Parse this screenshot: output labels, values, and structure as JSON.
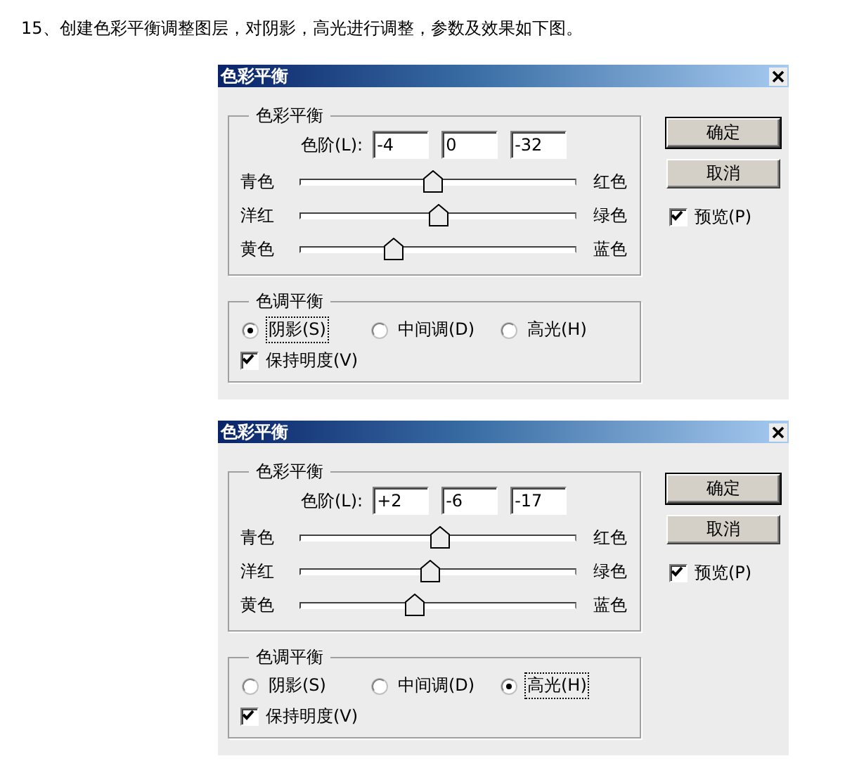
{
  "heading": "15、创建色彩平衡调整图层，对阴影，高光进行调整，参数及效果如下图。",
  "dialogs": [
    {
      "title": "色彩平衡",
      "color_balance": {
        "legend": "色彩平衡",
        "levels_label": "色阶(L):",
        "levels": [
          "-4",
          "0",
          "-32"
        ],
        "sliders": [
          {
            "left": "青色",
            "right": "红色",
            "level": 0.48
          },
          {
            "left": "洋红",
            "right": "绿色",
            "level": 0.5
          },
          {
            "left": "黄色",
            "right": "蓝色",
            "level": 0.34
          }
        ]
      },
      "tone_balance": {
        "legend": "色调平衡",
        "tones": [
          {
            "label": "阴影(S)",
            "selected": true
          },
          {
            "label": "中间调(D)",
            "selected": false
          },
          {
            "label": "高光(H)",
            "selected": false
          }
        ],
        "preserve": {
          "label": "保持明度(V)",
          "checked": true
        }
      },
      "buttons": [
        "确定",
        "取消"
      ],
      "preview": {
        "label": "预览(P)",
        "checked": true
      }
    },
    {
      "title": "色彩平衡",
      "color_balance": {
        "legend": "色彩平衡",
        "levels_label": "色阶(L):",
        "levels": [
          "+2",
          "-6",
          "-17"
        ],
        "sliders": [
          {
            "left": "青色",
            "right": "红色",
            "level": 0.51
          },
          {
            "left": "洋红",
            "right": "绿色",
            "level": 0.47
          },
          {
            "left": "黄色",
            "right": "蓝色",
            "level": 0.415
          }
        ]
      },
      "tone_balance": {
        "legend": "色调平衡",
        "tones": [
          {
            "label": "阴影(S)",
            "selected": false
          },
          {
            "label": "中间调(D)",
            "selected": false
          },
          {
            "label": "高光(H)",
            "selected": true
          }
        ],
        "preserve": {
          "label": "保持明度(V)",
          "checked": true
        }
      },
      "buttons": [
        "确定",
        "取消"
      ],
      "preview": {
        "label": "预览(P)",
        "checked": true
      }
    }
  ]
}
